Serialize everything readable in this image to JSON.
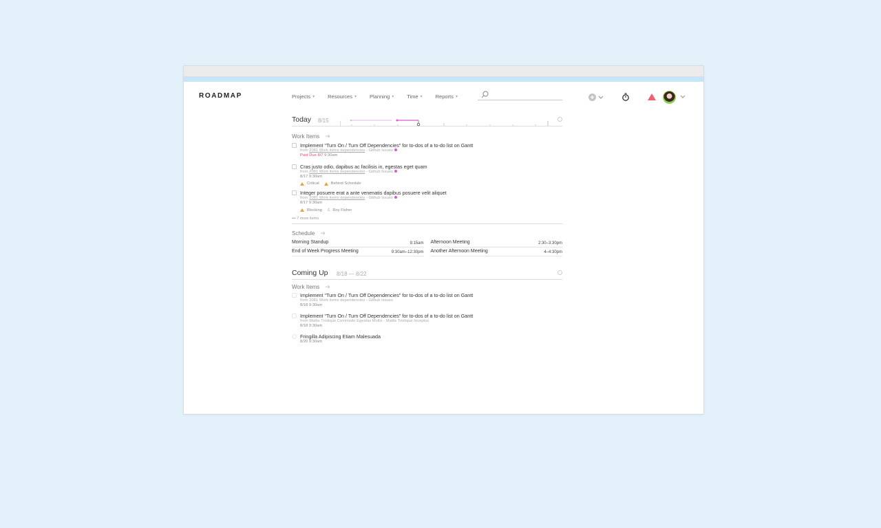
{
  "app": {
    "logo": "ROADMAP"
  },
  "nav": [
    {
      "label": "Projects"
    },
    {
      "label": "Resources"
    },
    {
      "label": "Planning"
    },
    {
      "label": "Time"
    },
    {
      "label": "Reports"
    }
  ],
  "search": {
    "placeholder": ""
  },
  "today": {
    "title": "Today",
    "date": "8/15",
    "work_items_label": "Work Items",
    "items": [
      {
        "title": "Implement “Turn On / Turn Off Dependencies” for to-dos of a to-do list on Gantt",
        "from": "from",
        "project": "2081 Work items dependencies",
        "source": "- Github Issues",
        "pastdue": "Past Due 8/7",
        "time": "9:30am"
      },
      {
        "title": "Cras justo odio, dapibus ac facilisis in, egestas eget quam",
        "from": "from",
        "project": "2081 Work items dependencies",
        "source": "- Github Issues",
        "due": "8/17 9:30am",
        "tag1": "Critical",
        "tag2": "Behind Schedule"
      },
      {
        "title": "Integer posuere erat a ante venenatis dapibus posuere velit aliquet",
        "from": "from",
        "project": "2081 Work items dependencies",
        "source": "- Github Issues",
        "due": "8/17 9:30am",
        "tag1": "Blocking",
        "person": "Roy Fisher"
      }
    ],
    "more": "••• 7 more items",
    "schedule_label": "Schedule",
    "schedule": [
      {
        "name": "Morning Standup",
        "time": "9:15am"
      },
      {
        "name": "Afternoon Meeting",
        "time": "2:30–3:30pm"
      },
      {
        "name": "End of Week Progress Meeting",
        "time": "9:30am–12:30pm"
      },
      {
        "name": "Another Afternoon Meeting",
        "time": "4–4:30pm"
      }
    ]
  },
  "coming_up": {
    "title": "Coming Up",
    "date": "8/18 — 8/22",
    "work_items_label": "Work Items",
    "items": [
      {
        "title": "Implement “Turn On / Turn Off Dependencies” for to-dos of a to-do list on Gantt",
        "meta": "from 2081 Work items dependencies - Github Issues",
        "due": "8/18 9:30am"
      },
      {
        "title": "Implement “Turn On / Turn Off Dependencies” for to-dos of a to-do list on Gantt",
        "meta": "from Mattis Tristique Commodo Egestas Mollis - Mattis Tristique Inceptos",
        "due": "8/18 9:30am"
      },
      {
        "title": "Fringilla Adipiscing Etiam Malesuada",
        "due": "8/20 9:30am"
      }
    ]
  },
  "colors": {
    "accent_bar": "#c5e5fa",
    "past_due": "#e0506a",
    "warning": "#e8a33a",
    "timeline": "#d75ad5",
    "alert": "#f06070"
  },
  "icons": [
    "search-icon",
    "add-icon",
    "timer-icon",
    "alert-icon",
    "chevron-down-icon",
    "gear-icon",
    "arrow-right-icon",
    "warning-icon",
    "person-icon"
  ]
}
